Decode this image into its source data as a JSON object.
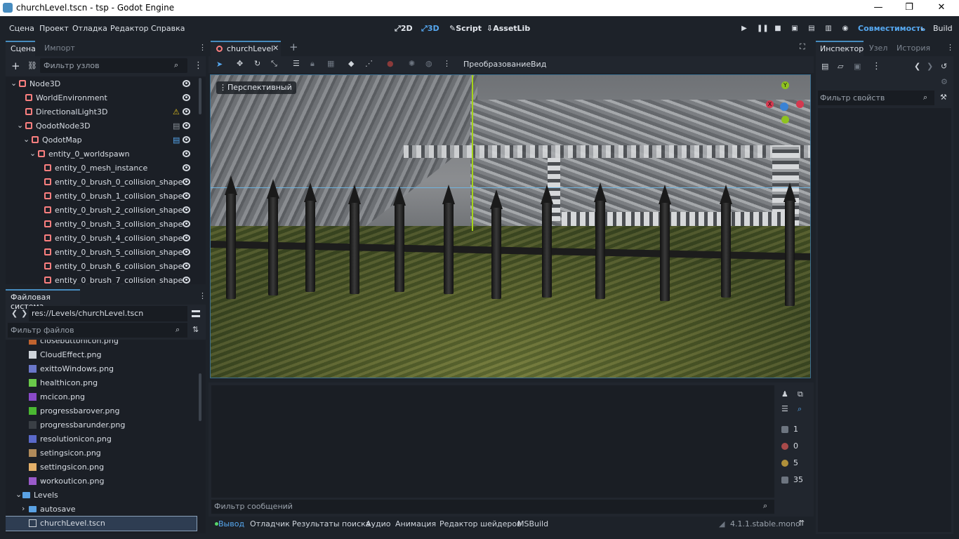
{
  "window": {
    "title": "churchLevel.tscn - tsp - Godot Engine",
    "minimize": "—",
    "maximize": "❐",
    "close": "✕"
  },
  "menu": [
    "Сцена",
    "Проект",
    "Отладка",
    "Редактор",
    "Справка"
  ],
  "workspaces": [
    {
      "label": "2D",
      "active": false
    },
    {
      "label": "3D",
      "active": true
    },
    {
      "label": "Script",
      "active": false
    },
    {
      "label": "AssetLib",
      "active": false
    }
  ],
  "run_tools": {
    "renderer": "Совместимость",
    "build": "Build"
  },
  "scene_dock": {
    "tabs": [
      "Сцена",
      "Импорт"
    ],
    "filter_placeholder": "Фильтр узлов",
    "nodes": [
      {
        "label": "Node3D",
        "indent": 0,
        "icon": "node3d-icon",
        "color": "#fc7f7f",
        "badge": ""
      },
      {
        "label": "WorldEnvironment",
        "indent": 1,
        "icon": "world-environment-icon",
        "color": "#fc7f7f",
        "badge": ""
      },
      {
        "label": "DirectionalLight3D",
        "indent": 1,
        "icon": "light-icon",
        "color": "#fc7f7f",
        "badge": "warning"
      },
      {
        "label": "QodotNode3D",
        "indent": 1,
        "icon": "qodot-icon",
        "color": "#fc7f7f",
        "badge": "script"
      },
      {
        "label": "QodotMap",
        "indent": 2,
        "icon": "qodot-icon",
        "color": "#fc7f7f",
        "badge": "script-blue"
      },
      {
        "label": "entity_0_worldspawn",
        "indent": 3,
        "icon": "static-body-icon",
        "color": "#fc7f7f",
        "badge": ""
      },
      {
        "label": "entity_0_mesh_instance",
        "indent": 4,
        "icon": "mesh-instance-icon",
        "color": "#fc7f7f",
        "badge": ""
      },
      {
        "label": "entity_0_brush_0_collision_shape",
        "indent": 4,
        "icon": "collision-shape-icon",
        "color": "#fc7f7f",
        "badge": ""
      },
      {
        "label": "entity_0_brush_1_collision_shape",
        "indent": 4,
        "icon": "collision-shape-icon",
        "color": "#fc7f7f",
        "badge": ""
      },
      {
        "label": "entity_0_brush_2_collision_shape",
        "indent": 4,
        "icon": "collision-shape-icon",
        "color": "#fc7f7f",
        "badge": ""
      },
      {
        "label": "entity_0_brush_3_collision_shape",
        "indent": 4,
        "icon": "collision-shape-icon",
        "color": "#fc7f7f",
        "badge": ""
      },
      {
        "label": "entity_0_brush_4_collision_shape",
        "indent": 4,
        "icon": "collision-shape-icon",
        "color": "#fc7f7f",
        "badge": ""
      },
      {
        "label": "entity_0_brush_5_collision_shape",
        "indent": 4,
        "icon": "collision-shape-icon",
        "color": "#fc7f7f",
        "badge": ""
      },
      {
        "label": "entity_0_brush_6_collision_shape",
        "indent": 4,
        "icon": "collision-shape-icon",
        "color": "#fc7f7f",
        "badge": ""
      },
      {
        "label": "entity_0_brush_7_collision_shape",
        "indent": 4,
        "icon": "collision-shape-icon",
        "color": "#fc7f7f",
        "badge": ""
      }
    ]
  },
  "filesystem_dock": {
    "tab": "Файловая система",
    "path": "res://Levels/churchLevel.tscn",
    "filter_placeholder": "Фильтр файлов",
    "files": [
      {
        "label": "closebuttonicon.png",
        "indent": 1,
        "icon": "image-icon",
        "color": "#c0632f"
      },
      {
        "label": "CloudEffect.png",
        "indent": 1,
        "icon": "image-icon",
        "color": "#cfd4da"
      },
      {
        "label": "exittoWindows.png",
        "indent": 1,
        "icon": "image-icon",
        "color": "#6a77c9"
      },
      {
        "label": "healthicon.png",
        "indent": 1,
        "icon": "image-icon",
        "color": "#6ac94a"
      },
      {
        "label": "mcicon.png",
        "indent": 1,
        "icon": "image-icon",
        "color": "#8a4ac9"
      },
      {
        "label": "progressbarover.png",
        "indent": 1,
        "icon": "image-icon",
        "color": "#4ab832"
      },
      {
        "label": "progressbarunder.png",
        "indent": 1,
        "icon": "image-icon",
        "color": "#3a3f45"
      },
      {
        "label": "resolutionicon.png",
        "indent": 1,
        "icon": "image-icon",
        "color": "#5a69c9"
      },
      {
        "label": "setingsicon.png",
        "indent": 1,
        "icon": "image-icon",
        "color": "#b08a5a"
      },
      {
        "label": "settingsicon.png",
        "indent": 1,
        "icon": "image-icon",
        "color": "#e3b06a"
      },
      {
        "label": "workouticon.png",
        "indent": 1,
        "icon": "image-icon",
        "color": "#9a5ac9"
      },
      {
        "label": "Levels",
        "indent": 0,
        "icon": "folder-icon",
        "color": "#5aa1e3",
        "expanded": true
      },
      {
        "label": "autosave",
        "indent": 1,
        "icon": "folder-icon",
        "color": "#5aa1e3"
      },
      {
        "label": "churchLevel.tscn",
        "indent": 1,
        "icon": "scene-file-icon",
        "color": "#cfd4da",
        "selected": true
      }
    ]
  },
  "editor": {
    "scene_tab": "churchLevel",
    "add_tab": "+",
    "toolbar_transform": "Преобразование",
    "toolbar_view": "Вид",
    "viewport_menu": "Перспективный",
    "gizmo_axes": [
      "X",
      "Y"
    ]
  },
  "output_panel": {
    "filter_placeholder": "Фильтр сообщений",
    "counters": [
      {
        "icon": "message-icon",
        "value": "1",
        "color": "#cfd4da"
      },
      {
        "icon": "error-icon",
        "value": "0",
        "color": "#e05a5a"
      },
      {
        "icon": "warning-icon",
        "value": "5",
        "color": "#e0b04a"
      },
      {
        "icon": "editor-icon",
        "value": "35",
        "color": "#cfd4da"
      }
    ],
    "tabs": [
      "Вывод",
      "Отладчик",
      "Результаты поиска",
      "Аудио",
      "Анимация",
      "Редактор шейдеров",
      "MSBuild"
    ],
    "version": "4.1.1.stable.mono"
  },
  "inspector": {
    "tabs": [
      "Инспектор",
      "Узел",
      "История"
    ],
    "filter_placeholder": "Фильтр свойств"
  },
  "colors": {
    "accent": "#478cbf",
    "active_tab_text": "#e4e8ee",
    "selection": "#2e3d52"
  }
}
